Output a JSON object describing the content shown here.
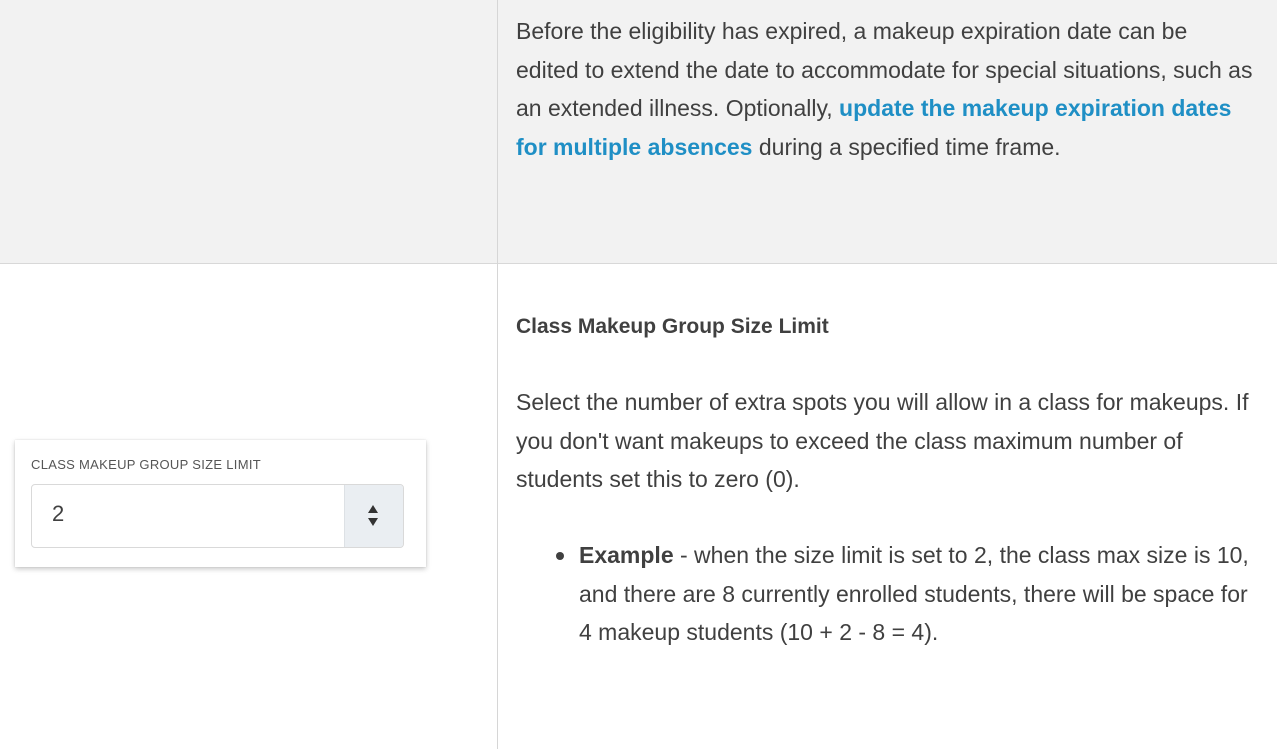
{
  "row1": {
    "text_before_link": "Before the eligibility has expired, a makeup expiration date can be edited to extend the date to accommodate for special situations, such as an extended illness. Optionally, ",
    "link_text": "update the makeup expiration dates for multiple absences",
    "text_after_link": " during a specified time frame."
  },
  "widget": {
    "label": "CLASS MAKEUP GROUP SIZE LIMIT",
    "value": "2",
    "stepper_up_icon": "triangle-up-icon",
    "stepper_down_icon": "triangle-down-icon"
  },
  "row2": {
    "heading": "Class Makeup Group Size Limit",
    "paragraph": "Select the number of extra spots you will allow in a class for makeups. If you don't want makeups to exceed the class maximum number of students set this to zero (0).",
    "bullets": [
      {
        "bold": "Example",
        "text": " - when the size limit is set to 2, the class max size is 10, and there are 8 currently enrolled students, there will be space for 4 makeup students (10 + 2 - 8 = 4)."
      }
    ]
  },
  "colors": {
    "link": "#1f8fc5",
    "text": "#404040",
    "shaded_row": "#f2f2f2"
  }
}
